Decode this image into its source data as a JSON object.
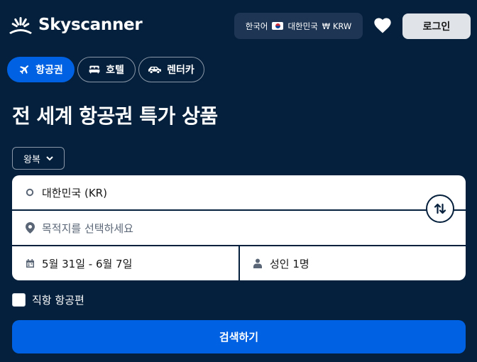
{
  "header": {
    "brand": "Skyscanner",
    "locale": {
      "language": "한국어",
      "region": "대한민국",
      "currency": "₩ KRW"
    },
    "login_label": "로그인"
  },
  "tabs": [
    {
      "label": "항공권",
      "icon": "plane-icon",
      "active": true
    },
    {
      "label": "호텔",
      "icon": "bed-icon",
      "active": false
    },
    {
      "label": "렌터카",
      "icon": "car-icon",
      "active": false
    }
  ],
  "main": {
    "title": "전 세계 항공권 특가 상품",
    "trip_type": "왕복",
    "origin": "대한민국 (KR)",
    "destination_placeholder": "목적지를 선택하세요",
    "dates": "5월 31일 - 6월 7일",
    "travellers": "성인 1명",
    "direct_flights_label": "직항 항공편",
    "direct_flights_checked": false,
    "search_label": "검색하기"
  },
  "colors": {
    "background": "#05203c",
    "accent": "#0062e3",
    "locale_bg": "#1e3654",
    "login_bg": "#e0e4e9"
  }
}
